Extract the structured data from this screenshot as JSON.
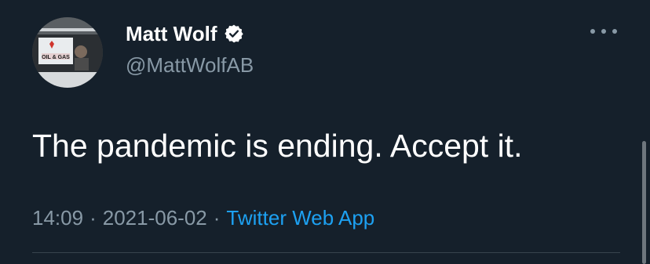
{
  "author": {
    "display_name": "Matt Wolf",
    "handle": "@MattWolfAB",
    "verified": true,
    "avatar_sign_text": "OIL & GAS"
  },
  "tweet": {
    "text": "The pandemic is ending. Accept it.",
    "time": "14:09",
    "date": "2021-06-02",
    "separator": "·",
    "source": "Twitter Web App"
  },
  "icons": {
    "verified": "verified-badge-icon",
    "more": "more-options-icon"
  },
  "colors": {
    "background": "#15202b",
    "primary_text": "#ffffff",
    "secondary_text": "#8899a6",
    "link": "#1da1f2",
    "divider": "#38444d"
  }
}
